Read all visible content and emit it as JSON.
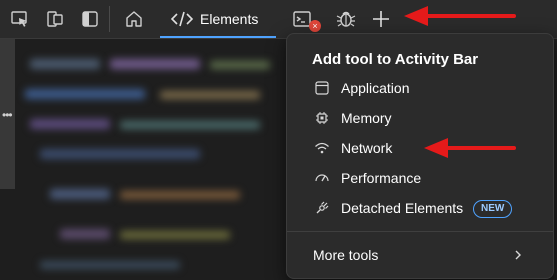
{
  "toolbar": {
    "icons": [
      "inspect-icon",
      "device-emulation-icon",
      "sidebar-toggle-icon",
      "home-icon",
      "elements-code-icon",
      "console-icon",
      "bug-icon",
      "plus-icon"
    ],
    "elements_tab_label": "Elements",
    "console_badge": "×"
  },
  "menu": {
    "title": "Add tool to Activity Bar",
    "items": [
      {
        "label": "Application",
        "icon": "application-icon"
      },
      {
        "label": "Memory",
        "icon": "memory-chip-icon"
      },
      {
        "label": "Network",
        "icon": "wifi-icon"
      },
      {
        "label": "Performance",
        "icon": "gauge-icon"
      },
      {
        "label": "Detached Elements",
        "icon": "detached-elements-icon",
        "badge": "NEW"
      }
    ],
    "more_tools_label": "More tools"
  },
  "colors": {
    "accent": "#4fa3ff",
    "arrow": "#e51a1a",
    "menu_bg": "#2b2b2b",
    "bar_bg": "#2b2b2b"
  }
}
